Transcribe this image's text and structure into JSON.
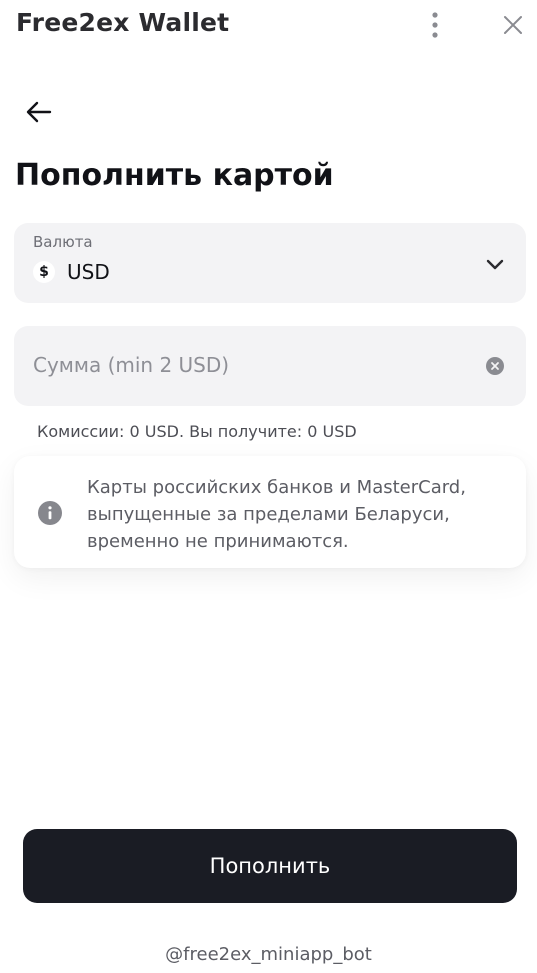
{
  "app": {
    "title": "Free2ex Wallet",
    "menu_icon": "more-vertical-icon",
    "close_icon": "close-icon"
  },
  "navigation": {
    "back_icon": "arrow-left-icon"
  },
  "page": {
    "title": "Пополнить картой"
  },
  "currency": {
    "label": "Валюта",
    "symbol": "$",
    "value": "USD",
    "dropdown_icon": "chevron-down-icon"
  },
  "amount": {
    "value": "",
    "placeholder": "Сумма (min 2 USD)",
    "clear_icon": "clear-circle-icon"
  },
  "commission_text": "Комиссии: 0 USD. Вы получите: 0 USD",
  "notice": {
    "icon": "info-icon",
    "text": "Карты российских банков и MasterCard, выпущенные за пределами Беларуси, временно не принимаются."
  },
  "submit": {
    "label": "Пополнить"
  },
  "footer": {
    "bot_handle": "@free2ex_miniapp_bot"
  },
  "colors": {
    "primary_button": "#1a1c24",
    "field_background": "#f3f3f5",
    "muted_text": "#8e8f96"
  }
}
